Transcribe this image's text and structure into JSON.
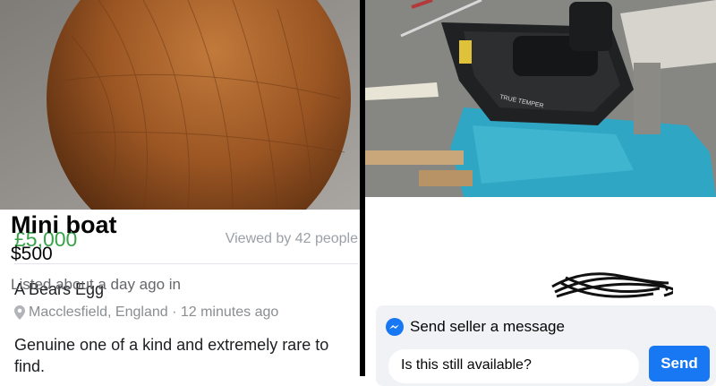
{
  "left_listing": {
    "price": "£5,000",
    "views": "Viewed by 42 people",
    "title": "A Bears Egg",
    "location": "Macclesfield, England · 12 minutes ago",
    "description": "Genuine one of a kind and extremely rare to find.",
    "location_icon": "map-pin-icon",
    "price_color": "#3aa34a"
  },
  "right_listing": {
    "title": "Mini boat",
    "price": "$500",
    "listed": "Listed about a day ago in",
    "message": {
      "header": "Send seller a message",
      "icon": "messenger-icon",
      "input_value": "Is this still available?",
      "send_label": "Send",
      "send_color": "#1877f2"
    }
  }
}
